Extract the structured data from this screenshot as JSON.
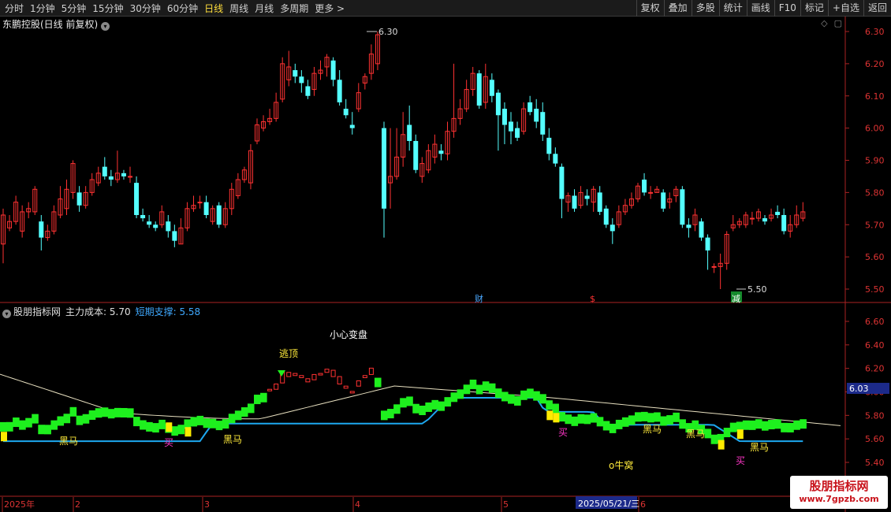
{
  "toolbar": {
    "periods": [
      "分时",
      "1分钟",
      "5分钟",
      "15分钟",
      "30分钟",
      "60分钟",
      "日线",
      "周线",
      "月线",
      "多周期",
      "更多 >"
    ],
    "active_period": "日线",
    "right": [
      "复权",
      "叠加",
      "多股",
      "统计",
      "画线",
      "F10",
      "标记",
      "+自选",
      "返回"
    ]
  },
  "stock_title": "东鹏控股(日线 前复权)",
  "indicator": {
    "name": "股朋指标网",
    "cost_label": "主力成本: 5.70",
    "support_label": "短期支撑: 5.58"
  },
  "price_axis": [
    "6.30",
    "6.20",
    "6.10",
    "6.00",
    "5.90",
    "5.80",
    "5.70",
    "5.60",
    "5.50"
  ],
  "ind_axis": [
    "6.60",
    "6.40",
    "6.20",
    "6.00",
    "5.80",
    "5.60",
    "5.40"
  ],
  "ind_current": "6.03",
  "high_label": "6.30",
  "low_label": "5.50",
  "markers": {
    "cai": "财",
    "dollar": "$",
    "jian": "减"
  },
  "date_axis": [
    "2025年",
    "2",
    "3",
    "4",
    "5",
    "6"
  ],
  "cursor_date": "2025/05/21/三",
  "signals": {
    "heima": "黑马",
    "mai": "买",
    "taoding": "逃顶",
    "xiaoxin": "小心变盘",
    "niuwo": "o牛窝"
  },
  "watermark": {
    "title": "股朋指标网",
    "url": "www.7gpzb.com"
  },
  "colors": {
    "up": "#ff3232",
    "down": "#54ffff",
    "support": "#1da8f0",
    "green": "#1ef01e",
    "yellow": "#ffeb00"
  },
  "chart_data": {
    "type": "candlestick",
    "ylim": [
      5.45,
      6.35
    ],
    "candles": [
      [
        5.64,
        5.73,
        5.75,
        5.58
      ],
      [
        5.69,
        5.71,
        5.73,
        5.68
      ],
      [
        5.71,
        5.77,
        5.79,
        5.7
      ],
      [
        5.68,
        5.74,
        5.76,
        5.66
      ],
      [
        5.74,
        5.75,
        5.77,
        5.72
      ],
      [
        5.74,
        5.81,
        5.82,
        5.73
      ],
      [
        5.71,
        5.66,
        5.73,
        5.62
      ],
      [
        5.66,
        5.68,
        5.7,
        5.65
      ],
      [
        5.68,
        5.74,
        5.76,
        5.67
      ],
      [
        5.73,
        5.78,
        5.82,
        5.72
      ],
      [
        5.75,
        5.81,
        5.84,
        5.73
      ],
      [
        5.8,
        5.89,
        5.9,
        5.78
      ],
      [
        5.8,
        5.76,
        5.82,
        5.74
      ],
      [
        5.76,
        5.8,
        5.82,
        5.75
      ],
      [
        5.8,
        5.84,
        5.86,
        5.79
      ],
      [
        5.83,
        5.86,
        5.88,
        5.82
      ],
      [
        5.88,
        5.85,
        5.91,
        5.84
      ],
      [
        5.85,
        5.84,
        5.87,
        5.82
      ],
      [
        5.84,
        5.86,
        5.93,
        5.83
      ],
      [
        5.86,
        5.85,
        5.87,
        5.84
      ],
      [
        5.85,
        5.85,
        5.88,
        5.83
      ],
      [
        5.83,
        5.73,
        5.85,
        5.72
      ],
      [
        5.73,
        5.72,
        5.75,
        5.71
      ],
      [
        5.71,
        5.7,
        5.73,
        5.69
      ],
      [
        5.7,
        5.69,
        5.71,
        5.68
      ],
      [
        5.7,
        5.74,
        5.76,
        5.69
      ],
      [
        5.71,
        5.68,
        5.73,
        5.66
      ],
      [
        5.68,
        5.65,
        5.7,
        5.63
      ],
      [
        5.64,
        5.69,
        5.72,
        5.64
      ],
      [
        5.69,
        5.75,
        5.77,
        5.68
      ],
      [
        5.75,
        5.76,
        5.79,
        5.74
      ],
      [
        5.77,
        5.77,
        5.79,
        5.75
      ],
      [
        5.77,
        5.73,
        5.79,
        5.72
      ],
      [
        5.71,
        5.75,
        5.76,
        5.7
      ],
      [
        5.76,
        5.7,
        5.77,
        5.69
      ],
      [
        5.7,
        5.75,
        5.77,
        5.69
      ],
      [
        5.75,
        5.81,
        5.83,
        5.73
      ],
      [
        5.79,
        5.84,
        5.86,
        5.78
      ],
      [
        5.84,
        5.87,
        5.88,
        5.83
      ],
      [
        5.83,
        5.93,
        5.95,
        5.81
      ],
      [
        5.96,
        6.01,
        6.03,
        5.95
      ],
      [
        6.0,
        6.02,
        6.04,
        5.99
      ],
      [
        6.02,
        6.03,
        6.06,
        6.01
      ],
      [
        6.03,
        6.08,
        6.11,
        6.02
      ],
      [
        6.09,
        6.2,
        6.22,
        6.08
      ],
      [
        6.15,
        6.19,
        6.24,
        6.13
      ],
      [
        6.18,
        6.16,
        6.2,
        6.14
      ],
      [
        6.16,
        6.14,
        6.18,
        6.11
      ],
      [
        6.13,
        6.1,
        6.15,
        6.09
      ],
      [
        6.12,
        6.17,
        6.19,
        6.1
      ],
      [
        6.17,
        6.18,
        6.21,
        6.15
      ],
      [
        6.19,
        6.22,
        6.23,
        6.16
      ],
      [
        6.21,
        6.15,
        6.22,
        6.13
      ],
      [
        6.15,
        6.08,
        6.18,
        6.07
      ],
      [
        6.06,
        6.04,
        6.09,
        6.03
      ],
      [
        6.01,
        6.0,
        6.05,
        5.98
      ],
      [
        6.06,
        6.11,
        6.14,
        6.05
      ],
      [
        6.14,
        6.16,
        6.17,
        6.12
      ],
      [
        6.17,
        6.23,
        6.26,
        6.15
      ],
      [
        6.2,
        6.29,
        6.3,
        6.18
      ],
      [
        6.0,
        5.75,
        6.02,
        5.66
      ],
      [
        5.83,
        5.85,
        6.0,
        5.75
      ],
      [
        5.85,
        5.91,
        6.0,
        5.84
      ],
      [
        5.91,
        5.98,
        6.05,
        5.88
      ],
      [
        6.01,
        5.96,
        6.07,
        5.93
      ],
      [
        5.96,
        5.87,
        5.98,
        5.86
      ],
      [
        5.85,
        5.89,
        5.91,
        5.83
      ],
      [
        5.87,
        5.93,
        5.95,
        5.86
      ],
      [
        5.91,
        5.95,
        5.98,
        5.89
      ],
      [
        5.93,
        5.92,
        5.95,
        5.9
      ],
      [
        5.92,
        5.99,
        6.02,
        5.9
      ],
      [
        5.99,
        6.03,
        6.2,
        5.97
      ],
      [
        6.03,
        6.06,
        6.09,
        6.01
      ],
      [
        6.06,
        6.12,
        6.15,
        6.05
      ],
      [
        6.12,
        6.17,
        6.19,
        6.1
      ],
      [
        6.17,
        6.07,
        6.18,
        6.06
      ],
      [
        6.08,
        6.16,
        6.2,
        6.06
      ],
      [
        6.15,
        6.1,
        6.17,
        6.08
      ],
      [
        6.11,
        6.04,
        6.12,
        5.93
      ],
      [
        6.06,
        6.01,
        6.08,
        5.95
      ],
      [
        6.02,
        5.99,
        6.05,
        5.95
      ],
      [
        6.0,
        5.97,
        6.02,
        5.96
      ],
      [
        5.99,
        6.06,
        6.08,
        5.98
      ],
      [
        6.08,
        6.05,
        6.1,
        6.04
      ],
      [
        6.06,
        6.02,
        6.09,
        6.0
      ],
      [
        6.05,
        5.98,
        6.08,
        5.96
      ],
      [
        5.97,
        5.92,
        6.0,
        5.9
      ],
      [
        5.92,
        5.89,
        5.94,
        5.88
      ],
      [
        5.88,
        5.78,
        5.89,
        5.72
      ],
      [
        5.77,
        5.79,
        5.8,
        5.74
      ],
      [
        5.79,
        5.75,
        5.81,
        5.74
      ],
      [
        5.76,
        5.8,
        5.82,
        5.75
      ],
      [
        5.79,
        5.78,
        5.81,
        5.76
      ],
      [
        5.77,
        5.81,
        5.82,
        5.74
      ],
      [
        5.8,
        5.74,
        5.82,
        5.73
      ],
      [
        5.75,
        5.7,
        5.76,
        5.69
      ],
      [
        5.7,
        5.68,
        5.72,
        5.64
      ],
      [
        5.7,
        5.74,
        5.76,
        5.69
      ],
      [
        5.74,
        5.76,
        5.78,
        5.73
      ],
      [
        5.76,
        5.78,
        5.8,
        5.75
      ],
      [
        5.78,
        5.82,
        5.83,
        5.77
      ],
      [
        5.84,
        5.8,
        5.86,
        5.79
      ],
      [
        5.8,
        5.8,
        5.82,
        5.78
      ],
      [
        5.8,
        5.81,
        5.82,
        5.8
      ],
      [
        5.8,
        5.75,
        5.81,
        5.74
      ],
      [
        5.77,
        5.78,
        5.8,
        5.75
      ],
      [
        5.79,
        5.81,
        5.82,
        5.77
      ],
      [
        5.81,
        5.7,
        5.82,
        5.69
      ],
      [
        5.7,
        5.69,
        5.72,
        5.66
      ],
      [
        5.7,
        5.73,
        5.75,
        5.68
      ],
      [
        5.71,
        5.66,
        5.72,
        5.65
      ],
      [
        5.66,
        5.62,
        5.67,
        5.56
      ],
      [
        5.57,
        5.57,
        5.58,
        5.55
      ],
      [
        5.57,
        5.58,
        5.61,
        5.5
      ],
      [
        5.58,
        5.67,
        5.68,
        5.56
      ],
      [
        5.69,
        5.7,
        5.73,
        5.68
      ],
      [
        5.7,
        5.71,
        5.72,
        5.69
      ],
      [
        5.7,
        5.73,
        5.74,
        5.69
      ],
      [
        5.72,
        5.72,
        5.74,
        5.7
      ],
      [
        5.72,
        5.74,
        5.75,
        5.71
      ],
      [
        5.72,
        5.71,
        5.73,
        5.7
      ],
      [
        5.72,
        5.73,
        5.75,
        5.71
      ],
      [
        5.74,
        5.73,
        5.76,
        5.72
      ],
      [
        5.73,
        5.68,
        5.75,
        5.67
      ],
      [
        5.68,
        5.7,
        5.73,
        5.66
      ],
      [
        5.7,
        5.73,
        5.76,
        5.69
      ],
      [
        5.72,
        5.74,
        5.77,
        5.71
      ]
    ]
  }
}
